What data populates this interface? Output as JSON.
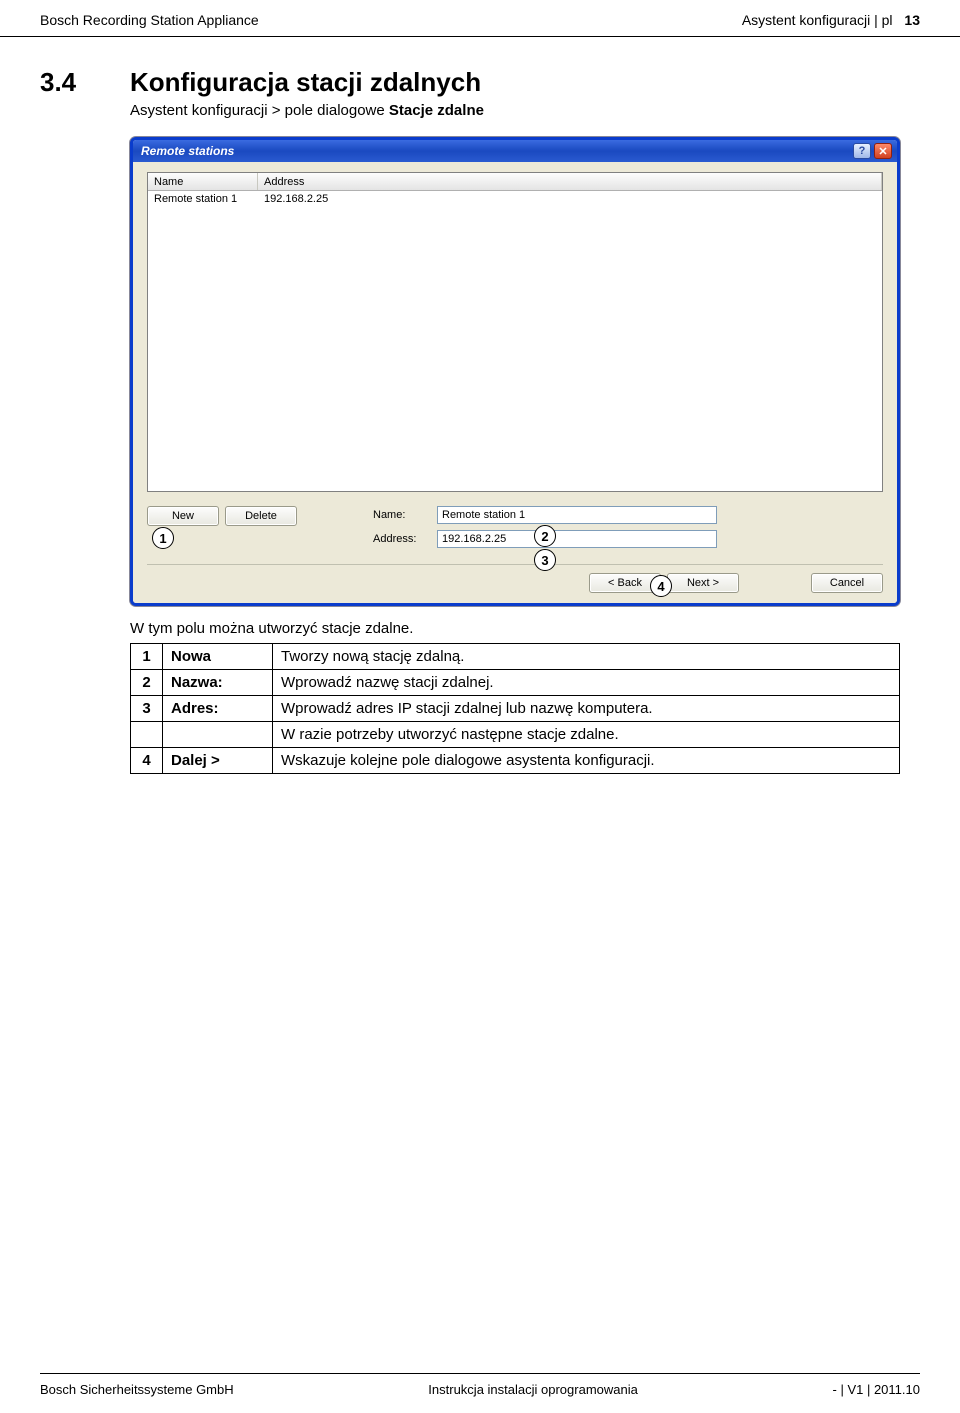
{
  "header": {
    "left": "Bosch Recording Station Appliance",
    "right_text": "Asystent konfiguracji | pl",
    "page_number": "13"
  },
  "section": {
    "number": "3.4",
    "title": "Konfiguracja stacji zdalnych",
    "breadcrumb_prefix": "Asystent konfiguracji > pole dialogowe ",
    "breadcrumb_bold": "Stacje zdalne"
  },
  "dialog": {
    "title": "Remote stations",
    "help_symbol": "?",
    "close_symbol": "✕",
    "list": {
      "col_name": "Name",
      "col_address": "Address",
      "rows": [
        {
          "name": "Remote station 1",
          "address": "192.168.2.25"
        }
      ]
    },
    "buttons": {
      "new": "New",
      "delete": "Delete",
      "back": "< Back",
      "next": "Next >",
      "cancel": "Cancel"
    },
    "fields": {
      "name_label": "Name:",
      "name_value": "Remote station 1",
      "address_label": "Address:",
      "address_value": "192.168.2.25"
    }
  },
  "callouts": {
    "c1": "1",
    "c2": "2",
    "c3": "3",
    "c4": "4"
  },
  "caption": "W tym polu można utworzyć stacje zdalne.",
  "table": {
    "rows": [
      {
        "n": "1",
        "label": "Nowa",
        "desc": "Tworzy nową stację zdalną."
      },
      {
        "n": "2",
        "label": "Nazwa:",
        "desc": "Wprowadź nazwę stacji zdalnej."
      },
      {
        "n": "3",
        "label": "Adres:",
        "desc": "Wprowadź adres IP stacji zdalnej lub nazwę komputera."
      },
      {
        "n": "",
        "label": "",
        "desc": "W razie potrzeby utworzyć następne stacje zdalne."
      },
      {
        "n": "4",
        "label": "Dalej >",
        "desc": "Wskazuje kolejne pole dialogowe asystenta konfiguracji."
      }
    ]
  },
  "footer": {
    "left": "Bosch Sicherheitssysteme GmbH",
    "center": "Instrukcja instalacji oprogramowania",
    "right": "- | V1 | 2011.10"
  }
}
